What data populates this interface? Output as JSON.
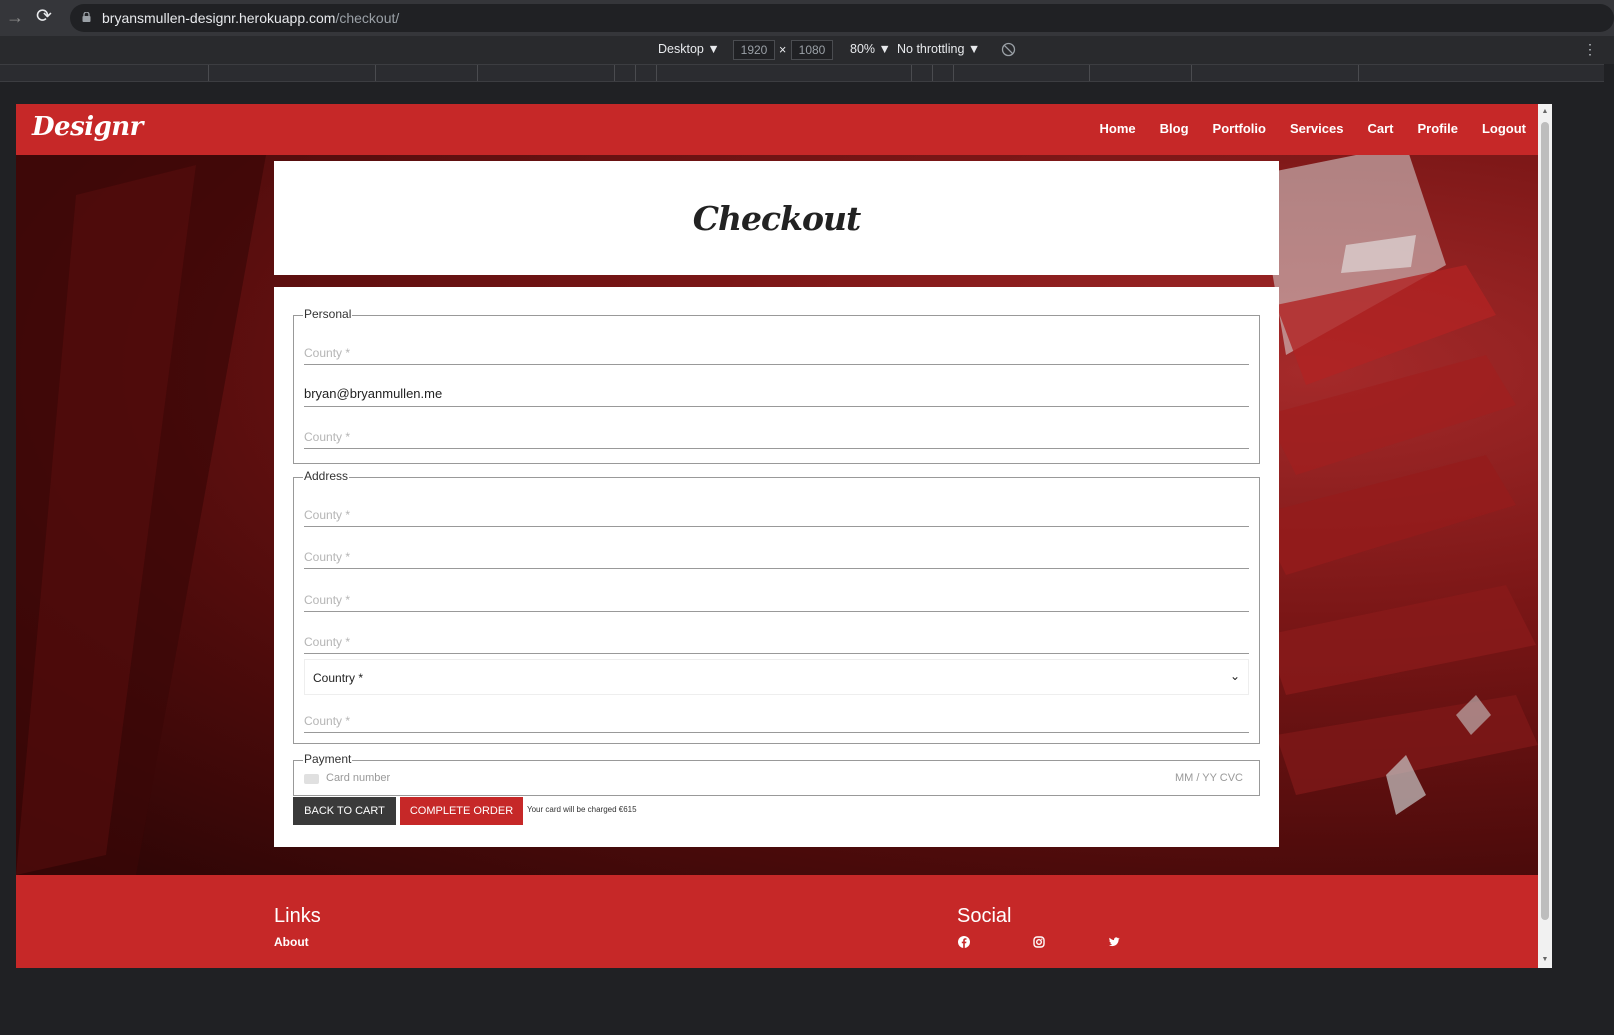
{
  "browser": {
    "url_host": "bryansmullen-designr.herokuapp.com",
    "url_path": "/checkout/",
    "device": "Desktop ▼",
    "width": "1920",
    "height": "1080",
    "times": "×",
    "zoom": "80% ▼",
    "throttling": "No throttling ▼",
    "more": "⋮"
  },
  "site": {
    "brand": "Designr",
    "nav": [
      "Home",
      "Blog",
      "Portfolio",
      "Services",
      "Cart",
      "Profile",
      "Logout"
    ]
  },
  "page": {
    "title": "Checkout"
  },
  "form": {
    "personal_legend": "Personal",
    "personal": [
      {
        "placeholder": "County *",
        "value": ""
      },
      {
        "placeholder": "",
        "value": "bryan@bryanmullen.me"
      },
      {
        "placeholder": "County *",
        "value": ""
      }
    ],
    "address_legend": "Address",
    "address": [
      {
        "placeholder": "County *"
      },
      {
        "placeholder": "County *"
      },
      {
        "placeholder": "County *"
      },
      {
        "placeholder": "County *"
      }
    ],
    "country_select": "Country *",
    "address_last": "County *",
    "payment_legend": "Payment",
    "card_placeholder": "Card number",
    "card_expiry": "MM / YY  CVC",
    "back_button": "BACK TO CART",
    "complete_button": "COMPLETE ORDER",
    "charge_note": "Your card will be charged €615"
  },
  "footer": {
    "links_heading": "Links",
    "about": "About",
    "social_heading": "Social",
    "social_icons": [
      "facebook-icon",
      "instagram-icon",
      "twitter-icon"
    ]
  },
  "colors": {
    "brand_red": "#c62828",
    "dark_button": "#3a3a3a"
  }
}
